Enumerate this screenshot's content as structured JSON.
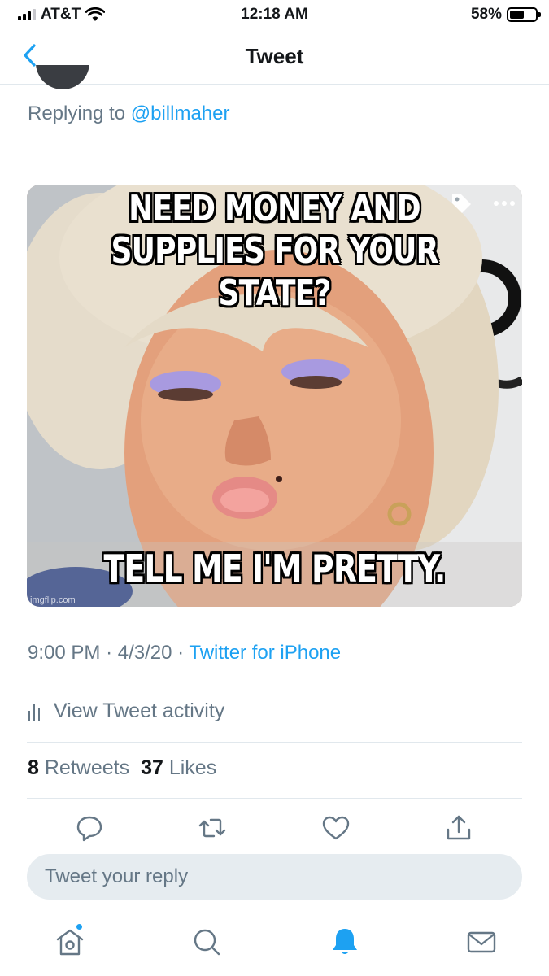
{
  "status_bar": {
    "carrier": "AT&T",
    "time": "12:18 AM",
    "battery": "58%",
    "battery_level": 0.58
  },
  "nav": {
    "title": "Tweet",
    "back_icon": "chevron-left-icon"
  },
  "tweet": {
    "replying_prefix": "Replying to",
    "replying_handle": "@billmaher",
    "media": {
      "top_text_line1": "NEED MONEY AND",
      "top_text_line2": "SUPPLIES FOR YOUR STATE?",
      "bottom_text": "TELL ME I'M PRETTY.",
      "watermark": "imgflip.com"
    },
    "time": "9:00 PM",
    "date": "4/3/20",
    "separator": "·",
    "source": "Twitter for iPhone",
    "activity_label": "View Tweet activity",
    "retweets_count": "8",
    "retweets_label": "Retweets",
    "likes_count": "37",
    "likes_label": "Likes"
  },
  "actions": [
    "reply-icon",
    "retweet-icon",
    "like-icon",
    "share-icon"
  ],
  "reply_box": {
    "placeholder": "Tweet your reply"
  },
  "tabbar": [
    "home-icon",
    "search-icon",
    "notifications-icon",
    "messages-icon"
  ],
  "colors": {
    "accent": "#1da1f2",
    "secondary_text": "#657786",
    "border": "#e1e8ed",
    "reply_bg": "#e6ecf0"
  }
}
